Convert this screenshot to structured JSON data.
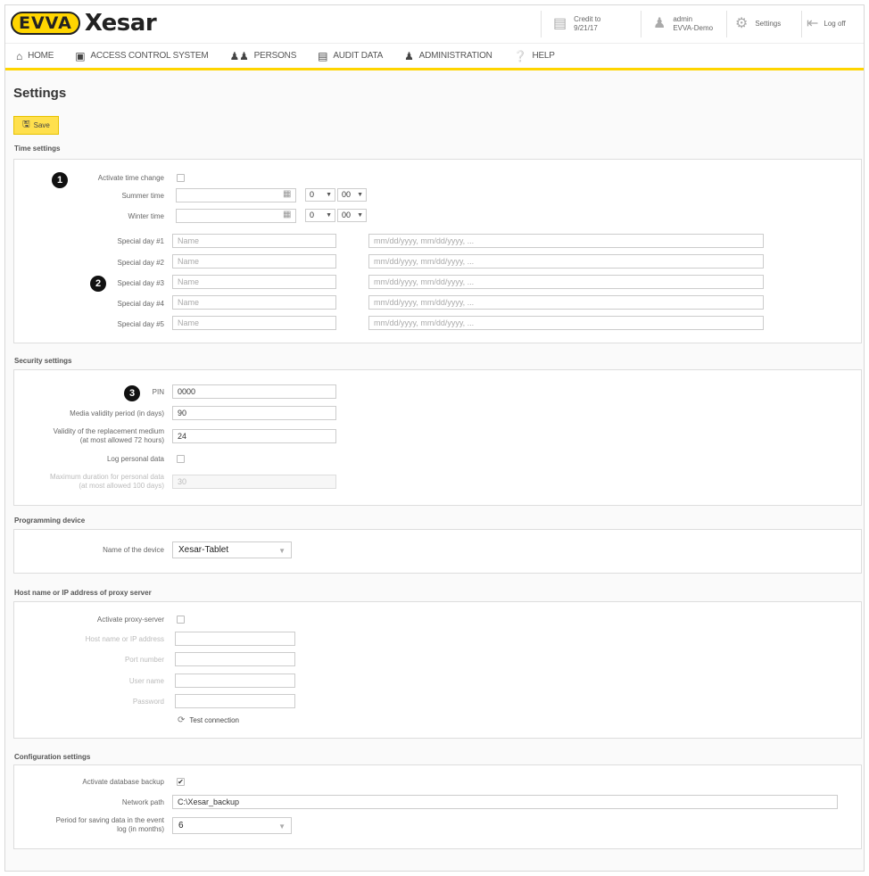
{
  "header": {
    "logo_brand": "EVVA",
    "logo_product": "Xesar",
    "credit_label": "Credit to",
    "credit_date": "9/21/17",
    "user_name": "admin",
    "user_org": "EVVA-Demo",
    "settings_label": "Settings",
    "logoff_label": "Log off"
  },
  "nav": {
    "items": [
      {
        "label": "HOME",
        "icon": "home-icon"
      },
      {
        "label": "ACCESS CONTROL SYSTEM",
        "icon": "lock-icon"
      },
      {
        "label": "PERSONS",
        "icon": "persons-icon"
      },
      {
        "label": "AUDIT DATA",
        "icon": "document-icon"
      },
      {
        "label": "ADMINISTRATION",
        "icon": "admin-icon"
      },
      {
        "label": "HELP",
        "icon": "help-icon"
      }
    ]
  },
  "page": {
    "title": "Settings",
    "save_label": "Save"
  },
  "time": {
    "section_title": "Time settings",
    "activate_label": "Activate time change",
    "summer_label": "Summer time",
    "winter_label": "Winter time",
    "summer_hour": "0",
    "summer_min": "00",
    "winter_hour": "0",
    "winter_min": "00",
    "special_days": [
      {
        "label": "Special day #1",
        "name_placeholder": "Name",
        "date_placeholder": "mm/dd/yyyy, mm/dd/yyyy, ..."
      },
      {
        "label": "Special day #2",
        "name_placeholder": "Name",
        "date_placeholder": "mm/dd/yyyy, mm/dd/yyyy, ..."
      },
      {
        "label": "Special day #3",
        "name_placeholder": "Name",
        "date_placeholder": "mm/dd/yyyy, mm/dd/yyyy, ..."
      },
      {
        "label": "Special day #4",
        "name_placeholder": "Name",
        "date_placeholder": "mm/dd/yyyy, mm/dd/yyyy, ..."
      },
      {
        "label": "Special day #5",
        "name_placeholder": "Name",
        "date_placeholder": "mm/dd/yyyy, mm/dd/yyyy, ..."
      }
    ]
  },
  "security": {
    "section_title": "Security settings",
    "pin_label": "PIN",
    "pin_value": "0000",
    "media_validity_label": "Media validity period (in days)",
    "media_validity_value": "90",
    "replacement_label_1": "Validity of the replacement medium",
    "replacement_label_2": "(at most allowed 72 hours)",
    "replacement_value": "24",
    "log_personal_label": "Log personal data",
    "max_duration_label_1": "Maximum duration for personal data",
    "max_duration_label_2": "(at most allowed 100 days)",
    "max_duration_value": "30"
  },
  "programming": {
    "section_title": "Programming device",
    "device_label": "Name of the device",
    "device_value": "Xesar-Tablet"
  },
  "proxy": {
    "section_title": "Host name or IP address of proxy server",
    "activate_label": "Activate proxy-server",
    "host_label": "Host name or IP address",
    "port_label": "Port number",
    "user_label": "User name",
    "password_label": "Password",
    "test_label": "Test connection"
  },
  "config": {
    "section_title": "Configuration settings",
    "backup_label": "Activate database backup",
    "network_label": "Network path",
    "network_value": "C:\\Xesar_backup",
    "period_label_1": "Period for saving data in the event",
    "period_label_2": "log (in months)",
    "period_value": "6"
  },
  "annotations": {
    "badge1": "1",
    "badge2": "2",
    "badge3": "3"
  },
  "colors": {
    "accent": "#ffd500",
    "save_button": "#ffe04d"
  }
}
